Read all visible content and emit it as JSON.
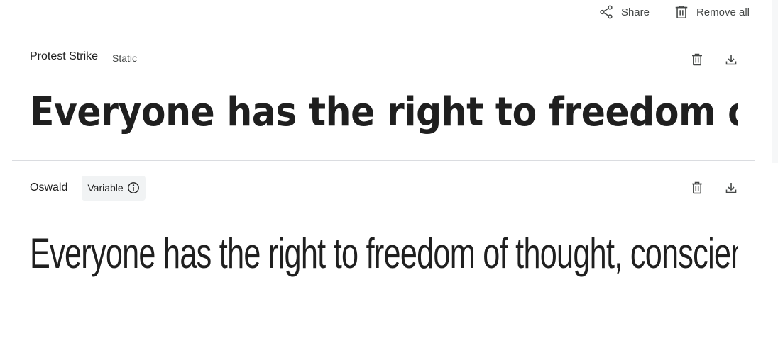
{
  "top_actions": {
    "share_label": "Share",
    "remove_all_label": "Remove all"
  },
  "fonts": [
    {
      "name": "Protest Strike",
      "tag": "Static",
      "preview": "Everyone has the right to freedom of thought, conscience and religion"
    },
    {
      "name": "Oswald",
      "tag": "Variable",
      "preview": "Everyone has the right to freedom of thought, conscience and religion"
    }
  ],
  "colors": {
    "text": "#1f1f1f",
    "muted": "#444746",
    "divider": "#dadce0",
    "chip_bg": "#f1f3f4"
  },
  "icons": [
    "share-icon",
    "trash-icon",
    "download-icon",
    "info-icon"
  ]
}
